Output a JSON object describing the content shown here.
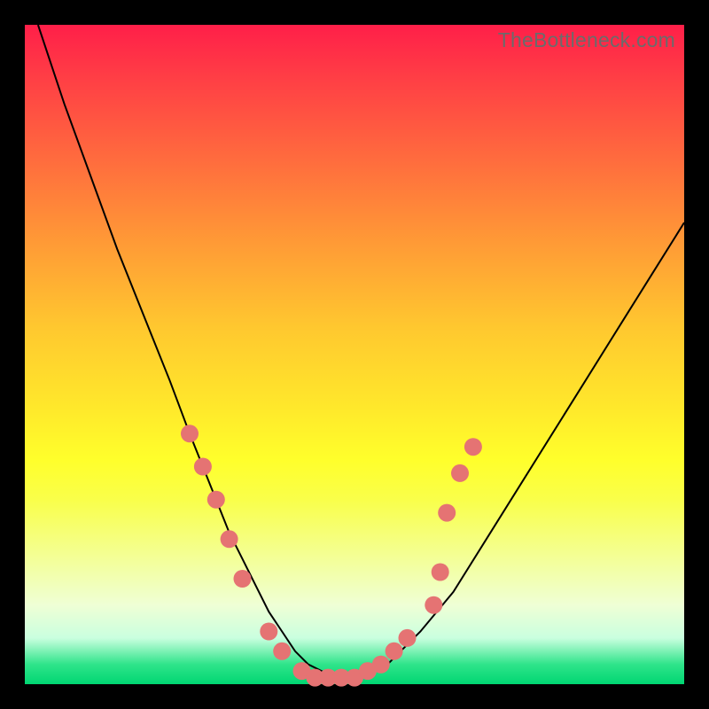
{
  "attribution": "TheBottleneck.com",
  "colors": {
    "gradient_top": "#ff1f49",
    "gradient_bottom": "#00d672",
    "curve": "#000000",
    "marker": "#e57373",
    "frame_bg": "#000000"
  },
  "chart_data": {
    "type": "line",
    "title": "",
    "xlabel": "",
    "ylabel": "",
    "xlim": [
      0,
      100
    ],
    "ylim": [
      0,
      100
    ],
    "series": [
      {
        "name": "bottleneck-curve",
        "x": [
          2,
          6,
          10,
          14,
          18,
          22,
          25,
          27,
          29,
          31,
          33,
          35,
          37,
          39,
          41,
          43,
          45,
          47,
          50,
          55,
          60,
          65,
          70,
          75,
          80,
          85,
          90,
          95,
          100
        ],
        "y": [
          100,
          88,
          77,
          66,
          56,
          46,
          38,
          33,
          28,
          23,
          19,
          15,
          11,
          8,
          5,
          3,
          2,
          1,
          1,
          3,
          8,
          14,
          22,
          30,
          38,
          46,
          54,
          62,
          70
        ]
      }
    ],
    "markers": {
      "name": "highlighted-points",
      "points": [
        {
          "x": 25,
          "y": 38
        },
        {
          "x": 27,
          "y": 33
        },
        {
          "x": 29,
          "y": 28
        },
        {
          "x": 31,
          "y": 22
        },
        {
          "x": 33,
          "y": 16
        },
        {
          "x": 37,
          "y": 8
        },
        {
          "x": 39,
          "y": 5
        },
        {
          "x": 42,
          "y": 2
        },
        {
          "x": 44,
          "y": 1
        },
        {
          "x": 46,
          "y": 1
        },
        {
          "x": 48,
          "y": 1
        },
        {
          "x": 50,
          "y": 1
        },
        {
          "x": 52,
          "y": 2
        },
        {
          "x": 54,
          "y": 3
        },
        {
          "x": 56,
          "y": 5
        },
        {
          "x": 58,
          "y": 7
        },
        {
          "x": 62,
          "y": 12
        },
        {
          "x": 63,
          "y": 17
        },
        {
          "x": 64,
          "y": 26
        },
        {
          "x": 66,
          "y": 32
        },
        {
          "x": 68,
          "y": 36
        }
      ]
    }
  }
}
